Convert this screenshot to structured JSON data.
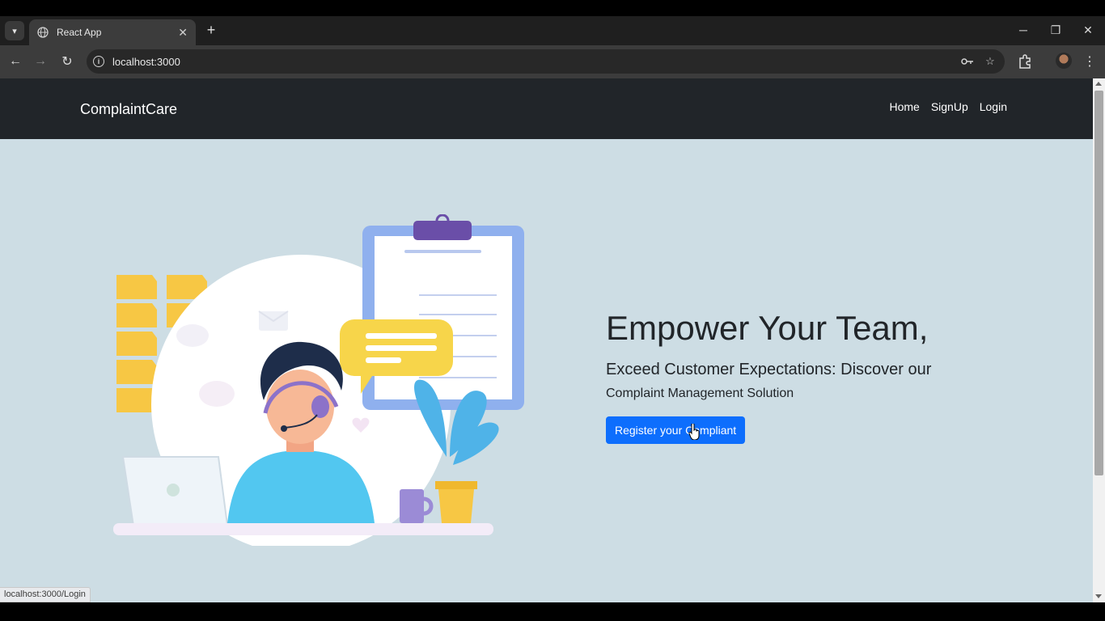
{
  "browser": {
    "tab_title": "React App",
    "url": "localhost:3000",
    "status_url": "localhost:3000/Login"
  },
  "navbar": {
    "brand": "ComplaintCare",
    "links": [
      "Home",
      "SignUp",
      "Login"
    ]
  },
  "hero": {
    "title": "Empower Your Team,",
    "subtitle_line1": "Exceed Customer Expectations: Discover our",
    "subtitle_line2": "Complaint Management Solution",
    "cta_label": "Register your Compliant"
  },
  "colors": {
    "navbar_bg": "#212529",
    "page_bg": "#cddde4",
    "cta_bg": "#0d6efd"
  },
  "icons": {
    "tab": "globe-icon",
    "omnibox": [
      "site-info-icon",
      "password-key-icon",
      "bookmark-star-icon"
    ],
    "toolbar": [
      "extensions-icon",
      "profile-avatar",
      "menu-icon"
    ]
  }
}
